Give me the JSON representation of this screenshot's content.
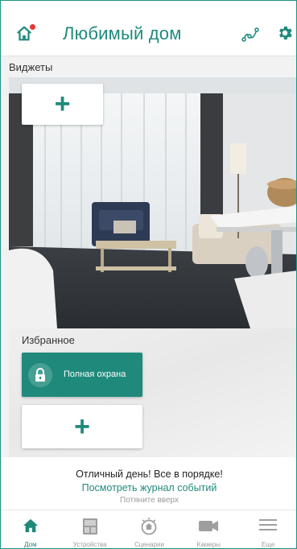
{
  "header": {
    "title": "Любимый дом"
  },
  "widgets": {
    "label": "Виджеты",
    "add_label": "+"
  },
  "favorites": {
    "label": "Избранное",
    "items": [
      {
        "label": "Полная охрана",
        "icon": "lock-icon"
      }
    ],
    "add_label": "+"
  },
  "status": {
    "message": "Отличный день! Все в порядке!",
    "journal_link": "Посмотреть журнал событий",
    "pull_hint": "Потяните вверх"
  },
  "nav": {
    "items": [
      {
        "label": "Дом",
        "icon": "home-icon",
        "active": true
      },
      {
        "label": "Устройства",
        "icon": "devices-icon",
        "active": false
      },
      {
        "label": "Сценарии",
        "icon": "scenarios-icon",
        "active": false
      },
      {
        "label": "Камеры",
        "icon": "camera-icon",
        "active": false
      },
      {
        "label": "Еще",
        "icon": "menu-icon",
        "active": false
      }
    ]
  },
  "colors": {
    "accent": "#1f8a7c",
    "alert_dot": "#e53935",
    "inactive": "#9e9e9e"
  }
}
